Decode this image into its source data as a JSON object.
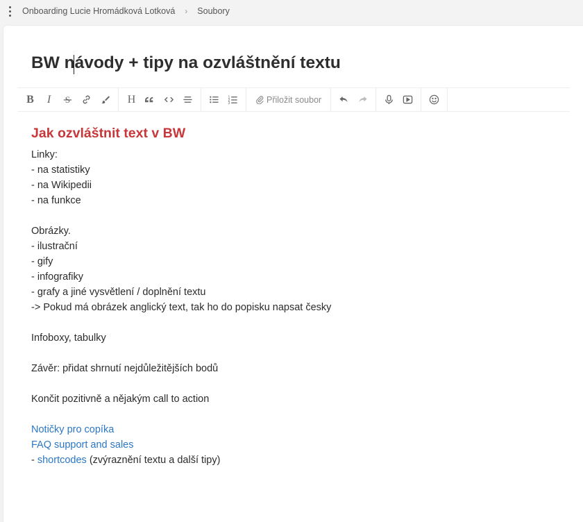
{
  "breadcrumb": {
    "items": [
      "Onboarding Lucie Hromádková Lotková",
      "Soubory"
    ],
    "separator": "›"
  },
  "document": {
    "title": "BW návody + tipy na ozvláštnění textu"
  },
  "toolbar": {
    "attach_label": "Přiložit soubor",
    "bold": "B",
    "italic": "I",
    "heading": "H"
  },
  "content": {
    "heading": "Jak ozvláštnit text v BW",
    "lines": {
      "l1": "Linky:",
      "l2": "- na statistiky",
      "l3": "- na Wikipedii",
      "l4": "- na funkce",
      "l5": "Obrázky.",
      "l6": "- ilustrační",
      "l7": "- gify",
      "l8": "- infografiky",
      "l9": "- grafy a jiné vysvětlení / doplnění textu",
      "l10": "-> Pokud má obrázek anglický text, tak ho do popisku napsat česky",
      "l11": "Infoboxy, tabulky",
      "l12": "Závěr: přidat shrnutí nejdůležitějších bodů",
      "l13": "Končit pozitivně a nějakým call to action"
    },
    "link1": "Notičky pro copíka",
    "link2": "FAQ support and sales",
    "last_prefix": "- ",
    "last_link": "shortcodes",
    "last_suffix": " (zvýraznění textu a další tipy)"
  },
  "colors": {
    "heading": "#c6383a",
    "link": "#2b77c4",
    "background": "#f3f3f4"
  }
}
